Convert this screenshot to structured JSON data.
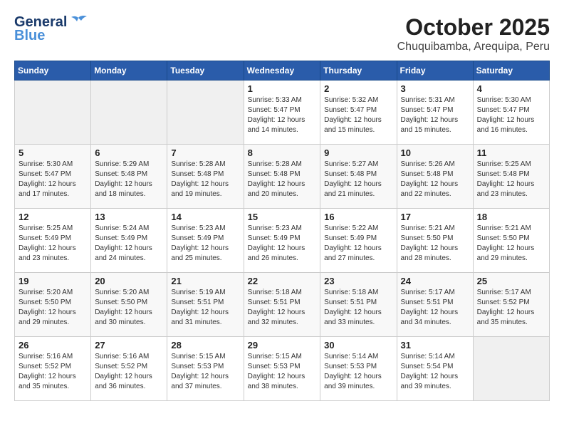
{
  "header": {
    "logo_line1": "General",
    "logo_line2": "Blue",
    "month": "October 2025",
    "location": "Chuquibamba, Arequipa, Peru"
  },
  "weekdays": [
    "Sunday",
    "Monday",
    "Tuesday",
    "Wednesday",
    "Thursday",
    "Friday",
    "Saturday"
  ],
  "weeks": [
    [
      {
        "day": "",
        "info": ""
      },
      {
        "day": "",
        "info": ""
      },
      {
        "day": "",
        "info": ""
      },
      {
        "day": "1",
        "info": "Sunrise: 5:33 AM\nSunset: 5:47 PM\nDaylight: 12 hours\nand 14 minutes."
      },
      {
        "day": "2",
        "info": "Sunrise: 5:32 AM\nSunset: 5:47 PM\nDaylight: 12 hours\nand 15 minutes."
      },
      {
        "day": "3",
        "info": "Sunrise: 5:31 AM\nSunset: 5:47 PM\nDaylight: 12 hours\nand 15 minutes."
      },
      {
        "day": "4",
        "info": "Sunrise: 5:30 AM\nSunset: 5:47 PM\nDaylight: 12 hours\nand 16 minutes."
      }
    ],
    [
      {
        "day": "5",
        "info": "Sunrise: 5:30 AM\nSunset: 5:47 PM\nDaylight: 12 hours\nand 17 minutes."
      },
      {
        "day": "6",
        "info": "Sunrise: 5:29 AM\nSunset: 5:48 PM\nDaylight: 12 hours\nand 18 minutes."
      },
      {
        "day": "7",
        "info": "Sunrise: 5:28 AM\nSunset: 5:48 PM\nDaylight: 12 hours\nand 19 minutes."
      },
      {
        "day": "8",
        "info": "Sunrise: 5:28 AM\nSunset: 5:48 PM\nDaylight: 12 hours\nand 20 minutes."
      },
      {
        "day": "9",
        "info": "Sunrise: 5:27 AM\nSunset: 5:48 PM\nDaylight: 12 hours\nand 21 minutes."
      },
      {
        "day": "10",
        "info": "Sunrise: 5:26 AM\nSunset: 5:48 PM\nDaylight: 12 hours\nand 22 minutes."
      },
      {
        "day": "11",
        "info": "Sunrise: 5:25 AM\nSunset: 5:48 PM\nDaylight: 12 hours\nand 23 minutes."
      }
    ],
    [
      {
        "day": "12",
        "info": "Sunrise: 5:25 AM\nSunset: 5:49 PM\nDaylight: 12 hours\nand 23 minutes."
      },
      {
        "day": "13",
        "info": "Sunrise: 5:24 AM\nSunset: 5:49 PM\nDaylight: 12 hours\nand 24 minutes."
      },
      {
        "day": "14",
        "info": "Sunrise: 5:23 AM\nSunset: 5:49 PM\nDaylight: 12 hours\nand 25 minutes."
      },
      {
        "day": "15",
        "info": "Sunrise: 5:23 AM\nSunset: 5:49 PM\nDaylight: 12 hours\nand 26 minutes."
      },
      {
        "day": "16",
        "info": "Sunrise: 5:22 AM\nSunset: 5:49 PM\nDaylight: 12 hours\nand 27 minutes."
      },
      {
        "day": "17",
        "info": "Sunrise: 5:21 AM\nSunset: 5:50 PM\nDaylight: 12 hours\nand 28 minutes."
      },
      {
        "day": "18",
        "info": "Sunrise: 5:21 AM\nSunset: 5:50 PM\nDaylight: 12 hours\nand 29 minutes."
      }
    ],
    [
      {
        "day": "19",
        "info": "Sunrise: 5:20 AM\nSunset: 5:50 PM\nDaylight: 12 hours\nand 29 minutes."
      },
      {
        "day": "20",
        "info": "Sunrise: 5:20 AM\nSunset: 5:50 PM\nDaylight: 12 hours\nand 30 minutes."
      },
      {
        "day": "21",
        "info": "Sunrise: 5:19 AM\nSunset: 5:51 PM\nDaylight: 12 hours\nand 31 minutes."
      },
      {
        "day": "22",
        "info": "Sunrise: 5:18 AM\nSunset: 5:51 PM\nDaylight: 12 hours\nand 32 minutes."
      },
      {
        "day": "23",
        "info": "Sunrise: 5:18 AM\nSunset: 5:51 PM\nDaylight: 12 hours\nand 33 minutes."
      },
      {
        "day": "24",
        "info": "Sunrise: 5:17 AM\nSunset: 5:51 PM\nDaylight: 12 hours\nand 34 minutes."
      },
      {
        "day": "25",
        "info": "Sunrise: 5:17 AM\nSunset: 5:52 PM\nDaylight: 12 hours\nand 35 minutes."
      }
    ],
    [
      {
        "day": "26",
        "info": "Sunrise: 5:16 AM\nSunset: 5:52 PM\nDaylight: 12 hours\nand 35 minutes."
      },
      {
        "day": "27",
        "info": "Sunrise: 5:16 AM\nSunset: 5:52 PM\nDaylight: 12 hours\nand 36 minutes."
      },
      {
        "day": "28",
        "info": "Sunrise: 5:15 AM\nSunset: 5:53 PM\nDaylight: 12 hours\nand 37 minutes."
      },
      {
        "day": "29",
        "info": "Sunrise: 5:15 AM\nSunset: 5:53 PM\nDaylight: 12 hours\nand 38 minutes."
      },
      {
        "day": "30",
        "info": "Sunrise: 5:14 AM\nSunset: 5:53 PM\nDaylight: 12 hours\nand 39 minutes."
      },
      {
        "day": "31",
        "info": "Sunrise: 5:14 AM\nSunset: 5:54 PM\nDaylight: 12 hours\nand 39 minutes."
      },
      {
        "day": "",
        "info": ""
      }
    ]
  ]
}
